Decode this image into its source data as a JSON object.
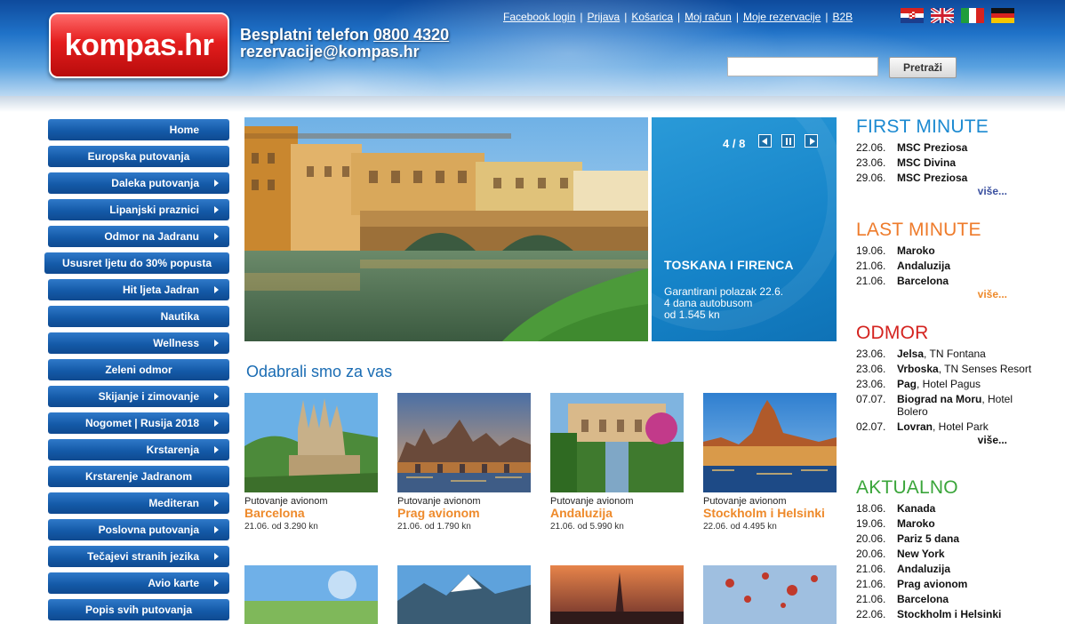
{
  "brand": {
    "logo_text": "kompas.hr",
    "phone_label": "Besplatni telefon",
    "phone_number": "0800 4320",
    "email": "rezervacije@kompas.hr"
  },
  "toplinks": [
    "Facebook login",
    "Prijava",
    "Košarica",
    "Moj račun",
    "Moje rezervacije",
    "B2B"
  ],
  "search": {
    "button_label": "Pretraži",
    "value": ""
  },
  "menu": [
    {
      "label": "Home",
      "arrow": false
    },
    {
      "label": "Europska putovanja",
      "arrow": false
    },
    {
      "label": "Daleka putovanja",
      "arrow": true
    },
    {
      "label": "Lipanjski praznici",
      "arrow": true
    },
    {
      "label": "Odmor na Jadranu",
      "arrow": true
    },
    {
      "label": "Ususret ljetu do 30% popusta",
      "arrow": false
    },
    {
      "label": "Hit ljeta Jadran",
      "arrow": true
    },
    {
      "label": "Nautika",
      "arrow": false
    },
    {
      "label": "Wellness",
      "arrow": true
    },
    {
      "label": "Zeleni odmor",
      "arrow": false
    },
    {
      "label": "Skijanje i zimovanje",
      "arrow": true
    },
    {
      "label": "Nogomet | Rusija 2018",
      "arrow": true
    },
    {
      "label": "Krstarenja",
      "arrow": true
    },
    {
      "label": "Krstarenje Jadranom",
      "arrow": false
    },
    {
      "label": "Mediteran",
      "arrow": true
    },
    {
      "label": "Poslovna putovanja",
      "arrow": true
    },
    {
      "label": "Tečajevi stranih jezika",
      "arrow": true
    },
    {
      "label": "Avio karte",
      "arrow": true
    },
    {
      "label": "Popis svih putovanja",
      "arrow": false
    }
  ],
  "slider": {
    "counter": "4 / 8",
    "title": "TOSKANA I FIRENCA",
    "line1": "Garantirani polazak 22.6.",
    "line2": "4 dana autobusom",
    "line3": "od 1.545 kn"
  },
  "section_title": "Odabrali smo za vas",
  "products": [
    {
      "pre": "Putovanje avionom",
      "name": "Barcelona",
      "price": "21.06. od 3.290 kn"
    },
    {
      "pre": "Putovanje avionom",
      "name": "Prag avionom",
      "price": "21.06. od 1.790 kn"
    },
    {
      "pre": "Putovanje avionom",
      "name": "Andaluzija",
      "price": "21.06. od 5.990 kn"
    },
    {
      "pre": "Putovanje avionom",
      "name": "Stockholm i Helsinki",
      "price": "22.06. od 4.495 kn"
    }
  ],
  "first_minute": {
    "title": "FIRST MINUTE",
    "color": "#1c8ad1",
    "rows": [
      {
        "date": "22.06.",
        "name": "MSC Preziosa",
        "extra": ""
      },
      {
        "date": "23.06.",
        "name": "MSC Divina",
        "extra": ""
      },
      {
        "date": "29.06.",
        "name": "MSC Preziosa",
        "extra": ""
      }
    ],
    "more": "više..."
  },
  "last_minute": {
    "title": "LAST MINUTE",
    "color": "#ee7b2b",
    "rows": [
      {
        "date": "19.06.",
        "name": "Maroko",
        "extra": ""
      },
      {
        "date": "21.06.",
        "name": "Andaluzija",
        "extra": ""
      },
      {
        "date": "21.06.",
        "name": "Barcelona",
        "extra": ""
      }
    ],
    "more": "više..."
  },
  "odmor": {
    "title": "ODMOR",
    "color": "#d4231f",
    "rows": [
      {
        "date": "23.06.",
        "name": "Jelsa",
        "extra": ", TN Fontana"
      },
      {
        "date": "23.06.",
        "name": "Vrboska",
        "extra": ", TN Senses Resort"
      },
      {
        "date": "23.06.",
        "name": "Pag",
        "extra": ", Hotel Pagus"
      },
      {
        "date": "07.07.",
        "name": "Biograd na Moru",
        "extra": ", Hotel Bolero"
      },
      {
        "date": "02.07.",
        "name": "Lovran",
        "extra": ", Hotel Park"
      }
    ],
    "more": "više..."
  },
  "aktualno": {
    "title": "AKTUALNO",
    "color": "#3aa53a",
    "rows": [
      {
        "date": "18.06.",
        "name": "Kanada",
        "extra": ""
      },
      {
        "date": "19.06.",
        "name": "Maroko",
        "extra": ""
      },
      {
        "date": "20.06.",
        "name": "Pariz 5 dana",
        "extra": ""
      },
      {
        "date": "20.06.",
        "name": "New York",
        "extra": ""
      },
      {
        "date": "21.06.",
        "name": "Andaluzija",
        "extra": ""
      },
      {
        "date": "21.06.",
        "name": "Prag avionom",
        "extra": ""
      },
      {
        "date": "21.06.",
        "name": "Barcelona",
        "extra": ""
      },
      {
        "date": "22.06.",
        "name": "Stockholm i Helsinki",
        "extra": ""
      }
    ]
  }
}
